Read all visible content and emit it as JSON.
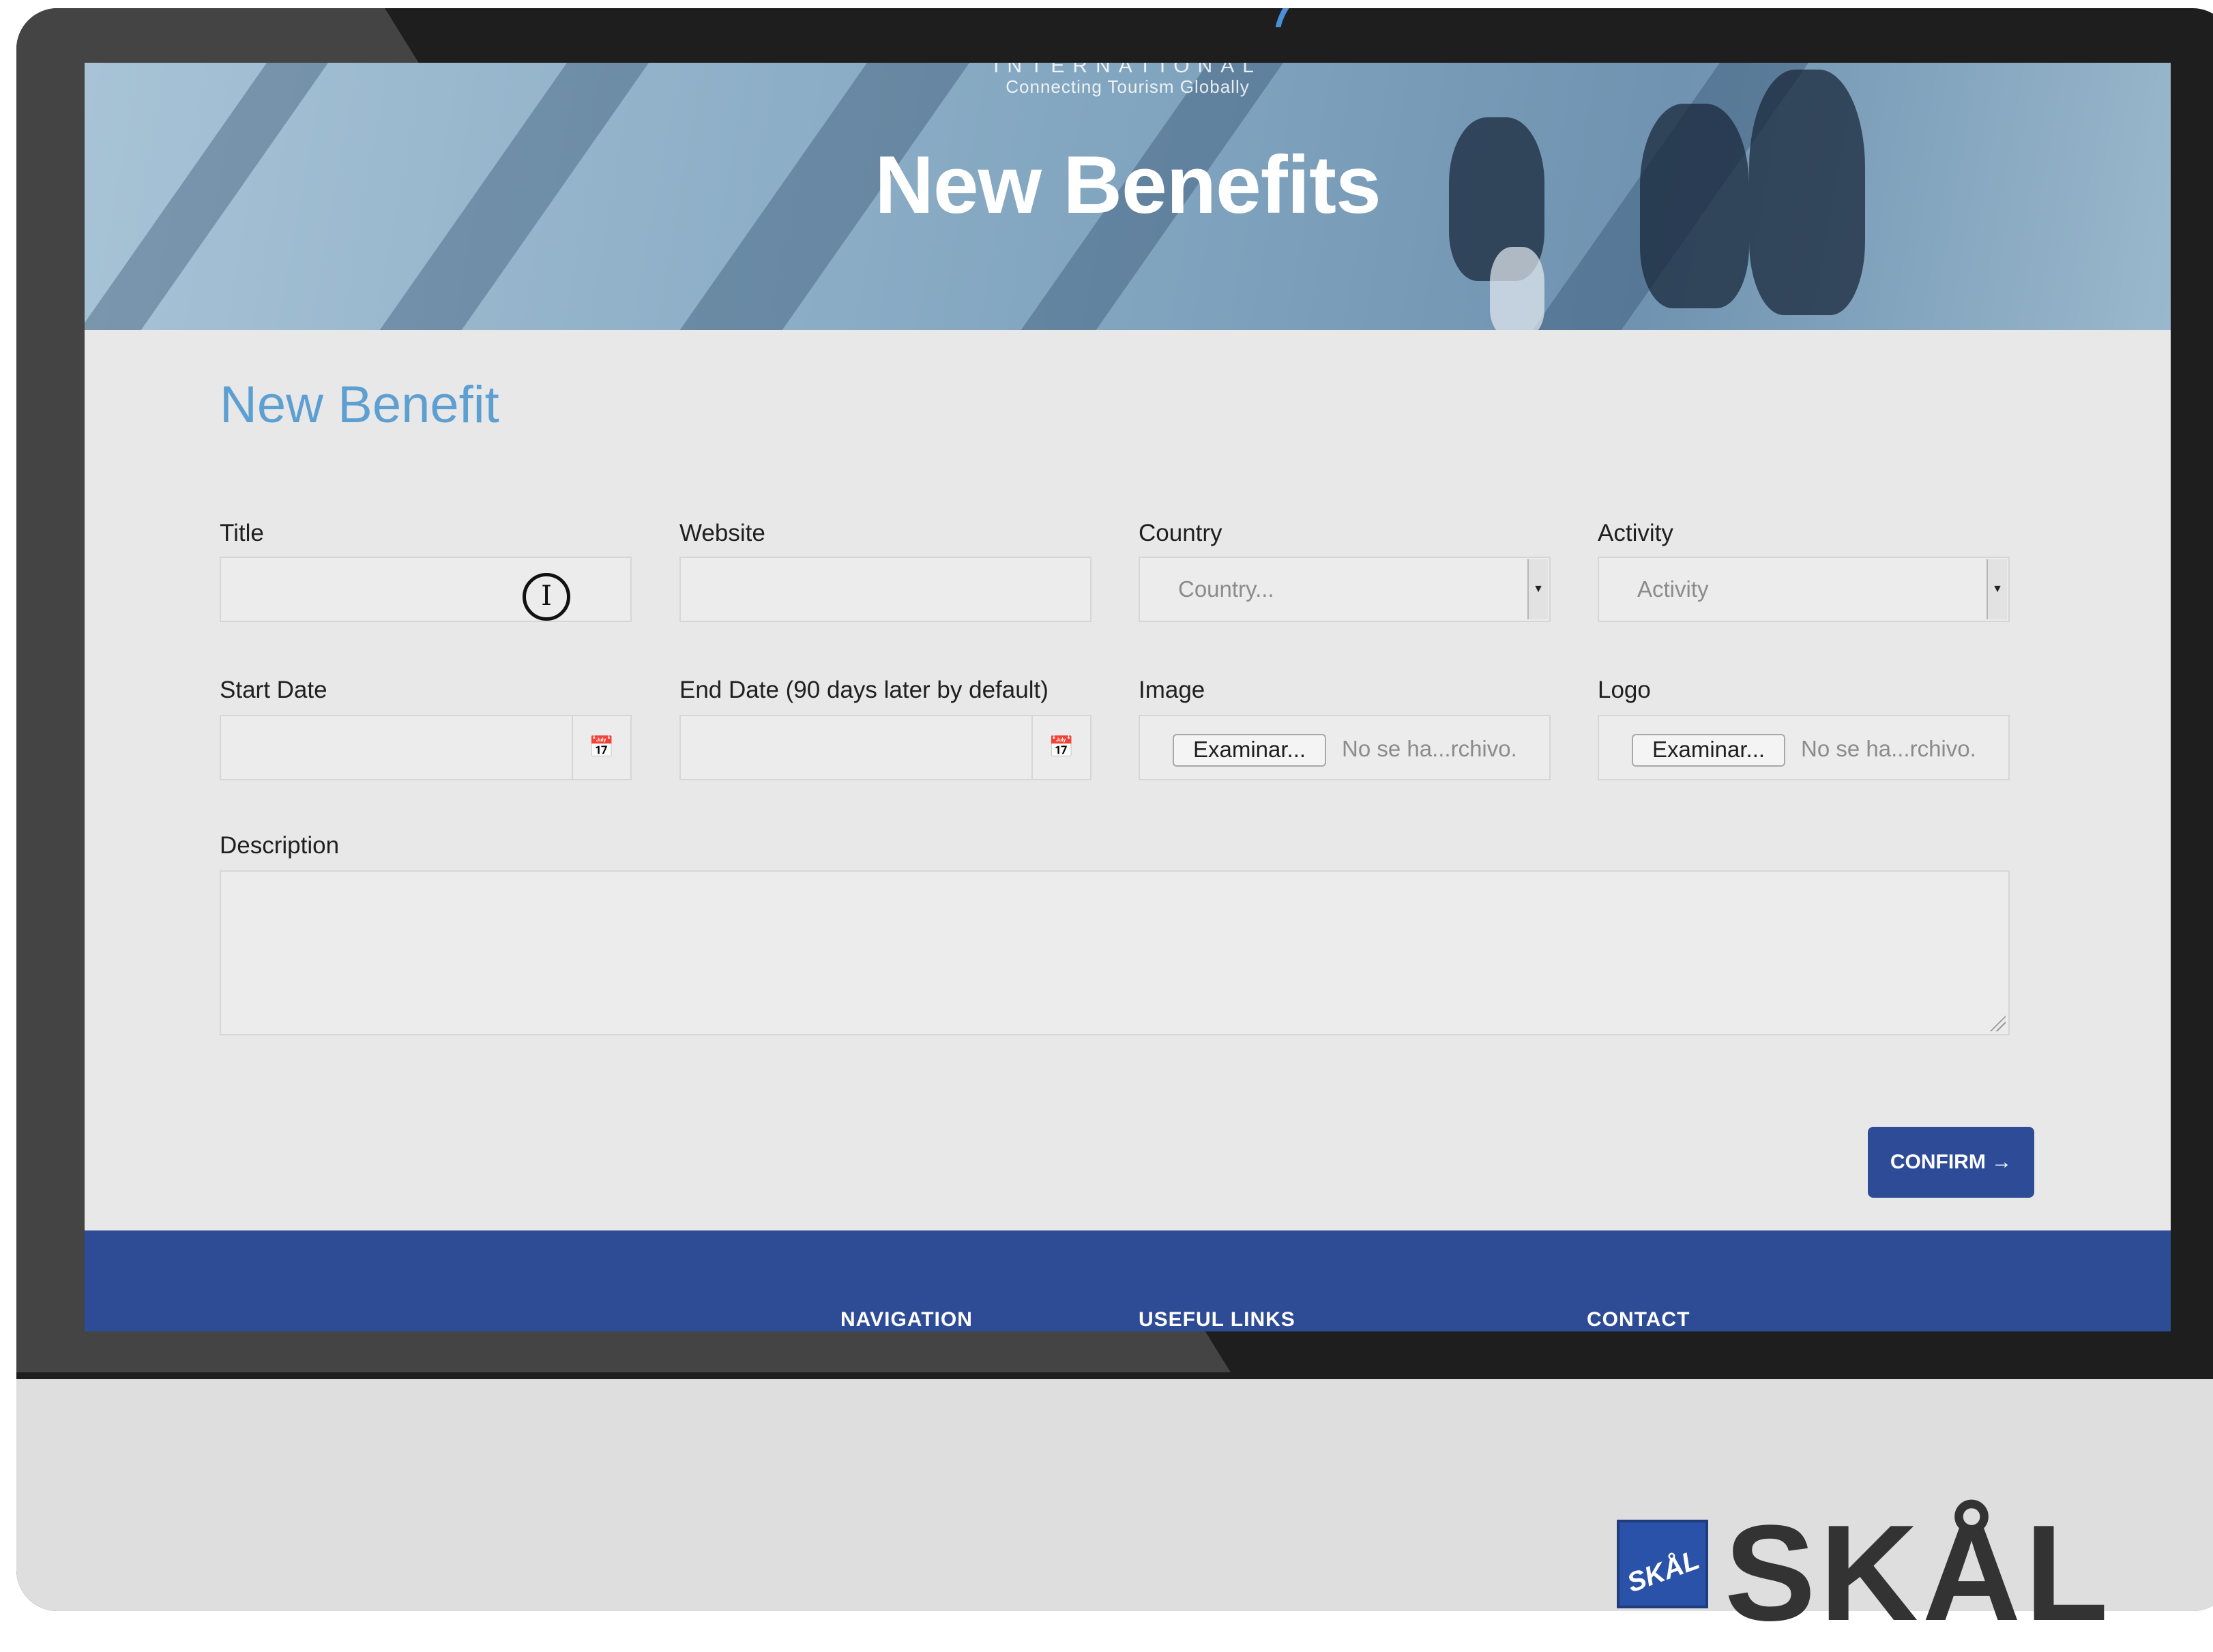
{
  "hero": {
    "brand": "INTERNATIONAL",
    "tagline": "Connecting Tourism Globally",
    "title": "New Benefits"
  },
  "form": {
    "heading": "New Benefit",
    "fields": {
      "title": {
        "label": "Title",
        "value": ""
      },
      "website": {
        "label": "Website",
        "value": ""
      },
      "country": {
        "label": "Country",
        "placeholder": "Country..."
      },
      "activity": {
        "label": "Activity",
        "placeholder": "Activity"
      },
      "start_date": {
        "label": "Start Date",
        "value": ""
      },
      "end_date": {
        "label": "End Date (90 days later by default)",
        "value": ""
      },
      "image": {
        "label": "Image",
        "button": "Examinar...",
        "status": "No se ha...rchivo."
      },
      "logo": {
        "label": "Logo",
        "button": "Examinar...",
        "status": "No se ha...rchivo."
      },
      "description": {
        "label": "Description",
        "value": ""
      }
    },
    "confirm_label": "CONFIRM →"
  },
  "footer": {
    "columns": [
      "NAVIGATION",
      "USEFUL LINKS",
      "CONTACT"
    ]
  },
  "logo": {
    "wordmark": "SKÅL",
    "mark_text": "SKÅL"
  },
  "icons": {
    "calendar": "calendar-icon",
    "dropdown": "chevron-down-icon",
    "text_cursor": "text-cursor-icon"
  },
  "colors": {
    "heading": "#5e9fd1",
    "confirm_button": "#2d4b97",
    "footer": "#2e4c96"
  }
}
